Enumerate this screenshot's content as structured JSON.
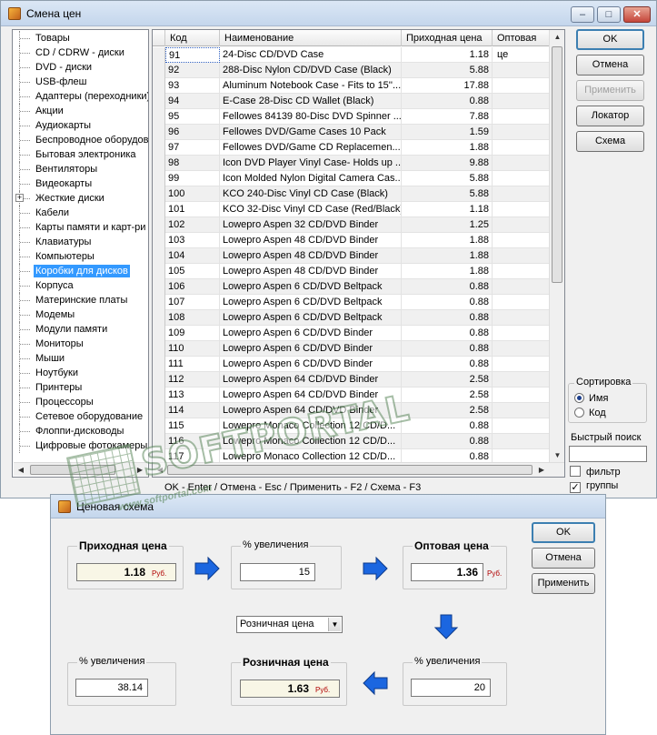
{
  "main_window": {
    "title": "Смена цен",
    "controls": {
      "minimize": "–",
      "maximize": "□",
      "close": "✕"
    }
  },
  "tree": {
    "items": [
      {
        "label": "Товары",
        "selected": false,
        "expandable": false
      },
      {
        "label": "CD / CDRW - диски",
        "selected": false,
        "expandable": false
      },
      {
        "label": "DVD - диски",
        "selected": false,
        "expandable": false
      },
      {
        "label": "USB-флеш",
        "selected": false,
        "expandable": false
      },
      {
        "label": "Адаптеры (переходники)",
        "selected": false,
        "expandable": false
      },
      {
        "label": "Акции",
        "selected": false,
        "expandable": false
      },
      {
        "label": "Аудиокарты",
        "selected": false,
        "expandable": false
      },
      {
        "label": "Беспроводное оборудов",
        "selected": false,
        "expandable": false
      },
      {
        "label": "Бытовая электроника",
        "selected": false,
        "expandable": false
      },
      {
        "label": "Вентиляторы",
        "selected": false,
        "expandable": false
      },
      {
        "label": "Видеокарты",
        "selected": false,
        "expandable": false
      },
      {
        "label": "Жесткие диски",
        "selected": false,
        "expandable": true
      },
      {
        "label": "Кабели",
        "selected": false,
        "expandable": false
      },
      {
        "label": "Карты памяти и карт-ри",
        "selected": false,
        "expandable": false
      },
      {
        "label": "Клавиатуры",
        "selected": false,
        "expandable": false
      },
      {
        "label": "Компьютеры",
        "selected": false,
        "expandable": false
      },
      {
        "label": "Коробки для дисков",
        "selected": true,
        "expandable": false
      },
      {
        "label": "Корпуса",
        "selected": false,
        "expandable": false
      },
      {
        "label": "Материнские платы",
        "selected": false,
        "expandable": false
      },
      {
        "label": "Модемы",
        "selected": false,
        "expandable": false
      },
      {
        "label": "Модули памяти",
        "selected": false,
        "expandable": false
      },
      {
        "label": "Мониторы",
        "selected": false,
        "expandable": false
      },
      {
        "label": "Мыши",
        "selected": false,
        "expandable": false
      },
      {
        "label": "Ноутбуки",
        "selected": false,
        "expandable": false
      },
      {
        "label": "Принтеры",
        "selected": false,
        "expandable": false
      },
      {
        "label": "Процессоры",
        "selected": false,
        "expandable": false
      },
      {
        "label": "Сетевое оборудование",
        "selected": false,
        "expandable": false
      },
      {
        "label": "Флоппи-дисководы",
        "selected": false,
        "expandable": false
      },
      {
        "label": "Цифровые фотокамеры",
        "selected": false,
        "expandable": false
      }
    ]
  },
  "grid": {
    "columns": [
      "Код",
      "Наименование",
      "Приходная цена",
      "Оптовая це"
    ],
    "rows": [
      {
        "code": "91",
        "name": "24-Disc CD/DVD Case",
        "price": "1.18"
      },
      {
        "code": "92",
        "name": "288-Disc Nylon CD/DVD Case (Black)",
        "price": "5.88"
      },
      {
        "code": "93",
        "name": "Aluminum Notebook Case - Fits to 15''...",
        "price": "17.88"
      },
      {
        "code": "94",
        "name": "E-Case 28-Disc CD Wallet (Black)",
        "price": "0.88"
      },
      {
        "code": "95",
        "name": "Fellowes 84139 80-Disc DVD Spinner ...",
        "price": "7.88"
      },
      {
        "code": "96",
        "name": "Fellowes DVD/Game Cases 10 Pack",
        "price": "1.59"
      },
      {
        "code": "97",
        "name": "Fellowes DVD/Game CD Replacemen...",
        "price": "1.88"
      },
      {
        "code": "98",
        "name": "Icon DVD Player Vinyl Case- Holds up ...",
        "price": "9.88"
      },
      {
        "code": "99",
        "name": "Icon Molded Nylon Digital Camera Cas...",
        "price": "5.88"
      },
      {
        "code": "100",
        "name": "KCO 240-Disc Vinyl CD Case (Black)",
        "price": "5.88"
      },
      {
        "code": "101",
        "name": "KCO 32-Disc Vinyl CD Case (Red/Black)",
        "price": "1.18"
      },
      {
        "code": "102",
        "name": "Lowepro Aspen 32 CD/DVD Binder",
        "price": "1.25"
      },
      {
        "code": "103",
        "name": "Lowepro Aspen 48 CD/DVD Binder",
        "price": "1.88"
      },
      {
        "code": "104",
        "name": "Lowepro Aspen 48 CD/DVD Binder",
        "price": "1.88"
      },
      {
        "code": "105",
        "name": "Lowepro Aspen 48 CD/DVD Binder",
        "price": "1.88"
      },
      {
        "code": "106",
        "name": "Lowepro Aspen 6 CD/DVD Beltpack",
        "price": "0.88"
      },
      {
        "code": "107",
        "name": "Lowepro Aspen 6 CD/DVD Beltpack",
        "price": "0.88"
      },
      {
        "code": "108",
        "name": "Lowepro Aspen 6 CD/DVD Beltpack",
        "price": "0.88"
      },
      {
        "code": "109",
        "name": "Lowepro Aspen 6 CD/DVD Binder",
        "price": "0.88"
      },
      {
        "code": "110",
        "name": "Lowepro Aspen 6 CD/DVD Binder",
        "price": "0.88"
      },
      {
        "code": "111",
        "name": "Lowepro Aspen 6 CD/DVD Binder",
        "price": "0.88"
      },
      {
        "code": "112",
        "name": "Lowepro Aspen 64 CD/DVD Binder",
        "price": "2.58"
      },
      {
        "code": "113",
        "name": "Lowepro Aspen 64 CD/DVD Binder",
        "price": "2.58"
      },
      {
        "code": "114",
        "name": "Lowepro Aspen 64 CD/DVD Binder",
        "price": "2.58"
      },
      {
        "code": "115",
        "name": "Lowepro Monaco Collection 12 CD/D...",
        "price": "0.88"
      },
      {
        "code": "116",
        "name": "Lowepro Monaco Collection 12 CD/D...",
        "price": "0.88"
      },
      {
        "code": "117",
        "name": "Lowepro Monaco Collection 12 CD/D...",
        "price": "0.88"
      }
    ]
  },
  "side": {
    "ok": "OK",
    "cancel": "Отмена",
    "apply": "Применить",
    "locator": "Локатор",
    "schema": "Схема",
    "sort_title": "Сортировка",
    "sort_name": "Имя",
    "sort_code": "Код",
    "quick_search": "Быстрый поиск",
    "filter": "фильтр",
    "groups": "группы"
  },
  "statusbar": "OK - Enter / Отмена - Esc / Применить - F2 / Схема - F3",
  "schema_window": {
    "title": "Ценовая схема",
    "purchase_label": "Приходная цена",
    "purchase_value": "1.18",
    "currency": "Руб.",
    "increase_label": "% увеличения",
    "increase1_value": "15",
    "wholesale_label": "Оптовая цена",
    "wholesale_value": "1.36",
    "dropdown_value": "Розничная цена",
    "increase2_value": "38.14",
    "retail_label": "Розничная цена",
    "retail_value": "1.63",
    "increase3_value": "20",
    "ok": "OK",
    "cancel": "Отмена",
    "apply": "Применить"
  },
  "watermark": {
    "brand": "SOFTPORTAL",
    "url": "www.softportal.com"
  },
  "colors": {
    "selection": "#3399ff",
    "arrow_blue": "#1b66e0",
    "currency_red": "#b00000"
  }
}
